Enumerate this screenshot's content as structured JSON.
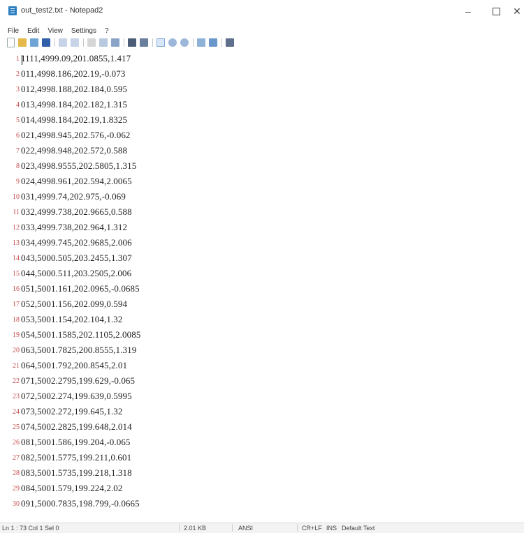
{
  "window": {
    "title": "out_test2.txt - Notepad2",
    "controls": {
      "minimize": "–",
      "close": "✕"
    }
  },
  "menu": [
    "File",
    "Edit",
    "View",
    "Settings",
    "?"
  ],
  "toolbar": {
    "icons": [
      "new-icon",
      "open-icon",
      "browse-icon",
      "save-icon",
      "undo-icon",
      "redo-icon",
      "cut-icon",
      "copy-icon",
      "paste-icon",
      "find-icon",
      "replace-icon",
      "word-wrap-icon",
      "zoom-in-icon",
      "zoom-out-icon",
      "scheme-icon",
      "scheme-config-icon",
      "exit-icon"
    ]
  },
  "editor": {
    "lines": [
      {
        "n": "1",
        "text": "1111,4999.09,201.0855,1.417"
      },
      {
        "n": "2",
        "text": "011,4998.186,202.19,-0.073"
      },
      {
        "n": "3",
        "text": "012,4998.188,202.184,0.595"
      },
      {
        "n": "4",
        "text": "013,4998.184,202.182,1.315"
      },
      {
        "n": "5",
        "text": "014,4998.184,202.19,1.8325"
      },
      {
        "n": "6",
        "text": "021,4998.945,202.576,-0.062"
      },
      {
        "n": "7",
        "text": "022,4998.948,202.572,0.588"
      },
      {
        "n": "8",
        "text": "023,4998.9555,202.5805,1.315"
      },
      {
        "n": "9",
        "text": "024,4998.961,202.594,2.0065"
      },
      {
        "n": "10",
        "text": "031,4999.74,202.975,-0.069"
      },
      {
        "n": "11",
        "text": "032,4999.738,202.9665,0.588"
      },
      {
        "n": "12",
        "text": "033,4999.738,202.964,1.312"
      },
      {
        "n": "13",
        "text": "034,4999.745,202.9685,2.006"
      },
      {
        "n": "14",
        "text": "043,5000.505,203.2455,1.307"
      },
      {
        "n": "15",
        "text": "044,5000.511,203.2505,2.006"
      },
      {
        "n": "16",
        "text": "051,5001.161,202.0965,-0.0685"
      },
      {
        "n": "17",
        "text": "052,5001.156,202.099,0.594"
      },
      {
        "n": "18",
        "text": "053,5001.154,202.104,1.32"
      },
      {
        "n": "19",
        "text": "054,5001.1585,202.1105,2.0085"
      },
      {
        "n": "20",
        "text": "063,5001.7825,200.8555,1.319"
      },
      {
        "n": "21",
        "text": "064,5001.792,200.8545,2.01"
      },
      {
        "n": "22",
        "text": "071,5002.2795,199.629,-0.065"
      },
      {
        "n": "23",
        "text": "072,5002.274,199.639,0.5995"
      },
      {
        "n": "24",
        "text": "073,5002.272,199.645,1.32"
      },
      {
        "n": "25",
        "text": "074,5002.2825,199.648,2.014"
      },
      {
        "n": "26",
        "text": "081,5001.586,199.204,-0.065"
      },
      {
        "n": "27",
        "text": "082,5001.5775,199.211,0.601"
      },
      {
        "n": "28",
        "text": "083,5001.5735,199.218,1.318"
      },
      {
        "n": "29",
        "text": "084,5001.579,199.224,2.02"
      },
      {
        "n": "30",
        "text": "091,5000.7835,198.799,-0.0665"
      }
    ]
  },
  "status": {
    "position": "Ln 1 : 73  Col 1  Sel 0",
    "size": "2.01 KB",
    "encoding": "ANSI",
    "line_endings": "CR+LF",
    "mode": "INS",
    "scheme": "Default Text"
  }
}
